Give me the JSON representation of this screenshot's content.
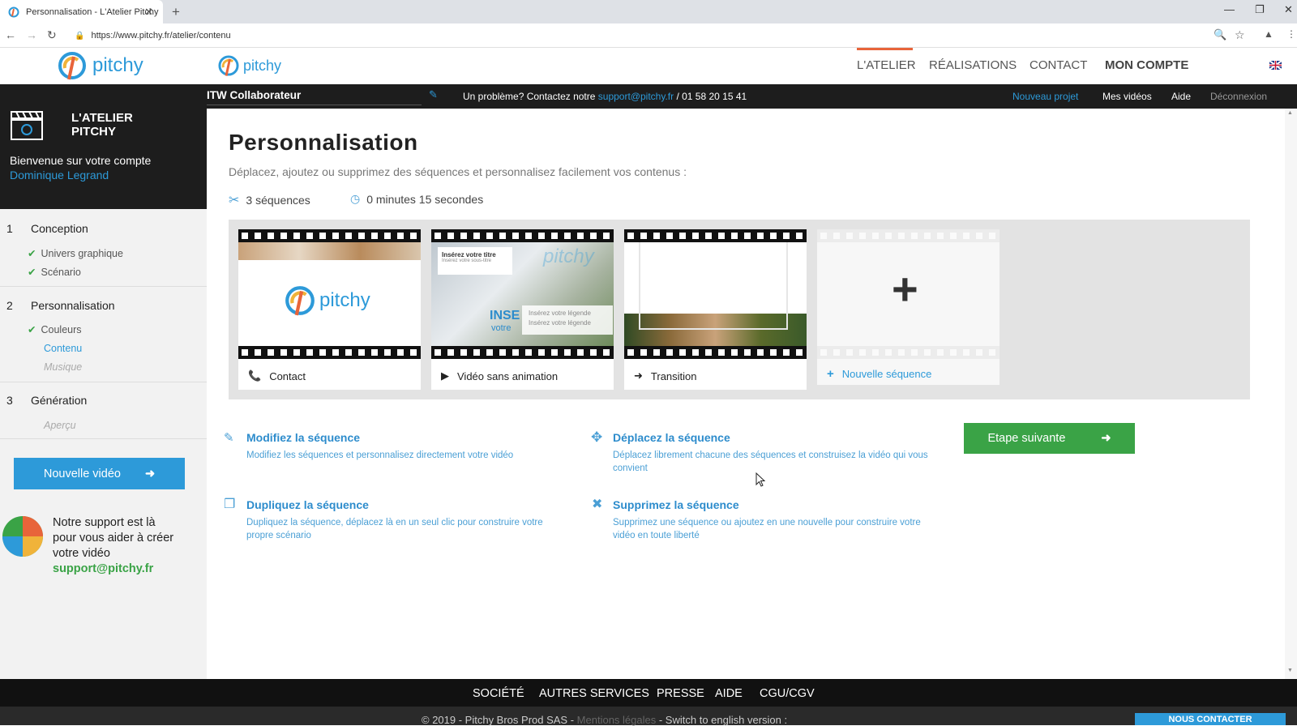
{
  "browser": {
    "tab_title": "Personnalisation - L'Atelier Pitchy",
    "tab_close": "✕",
    "new_tab": "+",
    "url": "https://www.pitchy.fr/atelier/contenu"
  },
  "site": {
    "logo_text": "pitchy",
    "nav": [
      "L'ATELIER",
      "RÉALISATIONS",
      "CONTACT",
      "MON COMPTE"
    ]
  },
  "sidebar": {
    "brand_line1": "L'ATELIER",
    "brand_line2": "PITCHY",
    "welcome": "Bienvenue sur votre compte",
    "user_name": "Dominique Legrand",
    "steps": [
      {
        "num": "1",
        "label": "Conception",
        "items": [
          "Univers graphique",
          "Scénario"
        ]
      },
      {
        "num": "2",
        "label": "Personnalisation",
        "items": [
          "Couleurs",
          "Contenu",
          "Musique"
        ]
      },
      {
        "num": "3",
        "label": "Génération",
        "items": [
          "Aperçu"
        ]
      }
    ],
    "new_video_label": "Nouvelle vidéo",
    "support_text_1": "Notre support est là",
    "support_text_2": "pour vous aider à créer",
    "support_text_3": "votre vidéo",
    "support_email": "support@pitchy.fr"
  },
  "projectbar": {
    "project_name": "ITW Collaborateur",
    "help_text": "Un problème? Contactez notre",
    "help_email": "support@pitchy.fr",
    "help_phone": "/ 01 58 20 15 41",
    "links": [
      "Nouveau projet",
      "Mes vidéos",
      "Aide",
      "Déconnexion"
    ]
  },
  "main": {
    "title": "Personnalisation",
    "subtitle": "Déplacez, ajoutez ou supprimez des séquences et personnalisez facilement vos contenus :",
    "sequence_count": "3 séquences",
    "duration": "0 minutes 15 secondes",
    "sequences": [
      {
        "label": "Contact",
        "icon": "phone-icon"
      },
      {
        "label": "Vidéo sans animation",
        "icon": "play-icon"
      },
      {
        "label": "Transition",
        "icon": "arrow-right-icon"
      }
    ],
    "thumb2_title": "Insérez votre titre",
    "thumb2_subtitle": "Insérez votre sous-titre",
    "thumb2_caption1": "Insérez votre légende",
    "thumb2_caption2": "Insérez votre légende",
    "thumb2_big": "INSE",
    "thumb2_big2": "votre",
    "thumb2_logo": "pitchy",
    "new_sequence_label": "Nouvelle séquence",
    "features": [
      {
        "title": "Modifiez la séquence",
        "desc": "Modifiez les séquences et personnalisez directement votre vidéo"
      },
      {
        "title": "Déplacez la séquence",
        "desc": "Déplacez librement chacune des séquences et construisez la vidéo qui vous convient"
      },
      {
        "title": "Dupliquez la séquence",
        "desc": "Dupliquez la séquence, déplacez là en un seul clic pour construire votre propre scénario"
      },
      {
        "title": "Supprimez la séquence",
        "desc": "Supprimez une séquence ou ajoutez en une nouvelle pour construire votre vidéo en toute liberté"
      }
    ],
    "next_step_label": "Etape suivante"
  },
  "footer": {
    "links": [
      "SOCIÉTÉ",
      "AUTRES SERVICES",
      "PRESSE",
      "AIDE",
      "CGU/CGV"
    ],
    "copyright": "© 2019 - Pitchy Bros Prod SAS -",
    "legal": "Mentions légales",
    "switch_lang": "- Switch to english version :",
    "contact_btn": "NOUS CONTACTER"
  },
  "colors": {
    "accent_blue": "#2d9ad9",
    "accent_green": "#3aa346",
    "accent_orange": "#e8643a",
    "dark": "#1d1d1d"
  }
}
